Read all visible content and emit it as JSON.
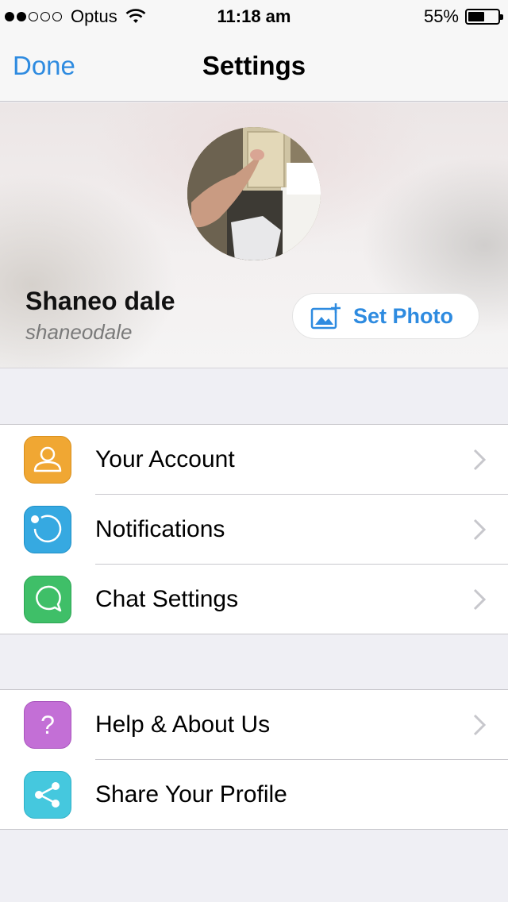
{
  "status_bar": {
    "carrier": "Optus",
    "time": "11:18 am",
    "battery_percent": "55%",
    "battery_level": 0.55,
    "signal_bars_filled": 2,
    "signal_bars_total": 5
  },
  "nav": {
    "done_label": "Done",
    "title": "Settings"
  },
  "profile": {
    "name": "Shaneo dale",
    "username": "shaneodale",
    "set_photo_label": "Set Photo"
  },
  "menu_groups": [
    {
      "items": [
        {
          "label": "Your Account",
          "icon": "person-icon",
          "color": "#f0a733",
          "chevron": true
        },
        {
          "label": "Notifications",
          "icon": "notification-icon",
          "color": "#36a9e1",
          "chevron": true
        },
        {
          "label": "Chat Settings",
          "icon": "chat-bubble-icon",
          "color": "#3fbf68",
          "chevron": true
        }
      ]
    },
    {
      "items": [
        {
          "label": "Help & About Us",
          "icon": "question-icon",
          "color": "#c36fd6",
          "chevron": true
        },
        {
          "label": "Share Your Profile",
          "icon": "share-icon",
          "color": "#45c8de",
          "chevron": false
        }
      ]
    }
  ],
  "colors": {
    "accent": "#2e8be0",
    "background": "#efeff4"
  }
}
